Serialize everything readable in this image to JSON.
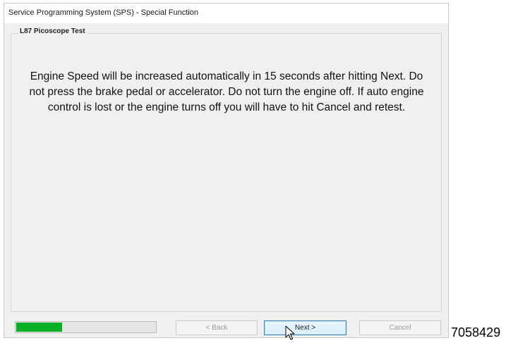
{
  "window": {
    "title": "Service Programming System (SPS) - Special Function"
  },
  "group": {
    "label": "L87 Picoscope Test"
  },
  "message": "Engine Speed will be increased automatically in 15 seconds after hitting Next. Do not press the brake pedal or accelerator. Do not turn the engine off. If auto engine control is lost or the engine turns off you will have to hit Cancel and retest.",
  "progress": {
    "fraction": 0.33,
    "color": "#06b025"
  },
  "buttons": {
    "back_label": "< Back",
    "next_label": "Next >",
    "cancel_label": "Cancel"
  },
  "cursor_icon": "arrow-cursor-icon",
  "figure_id": "7058429"
}
